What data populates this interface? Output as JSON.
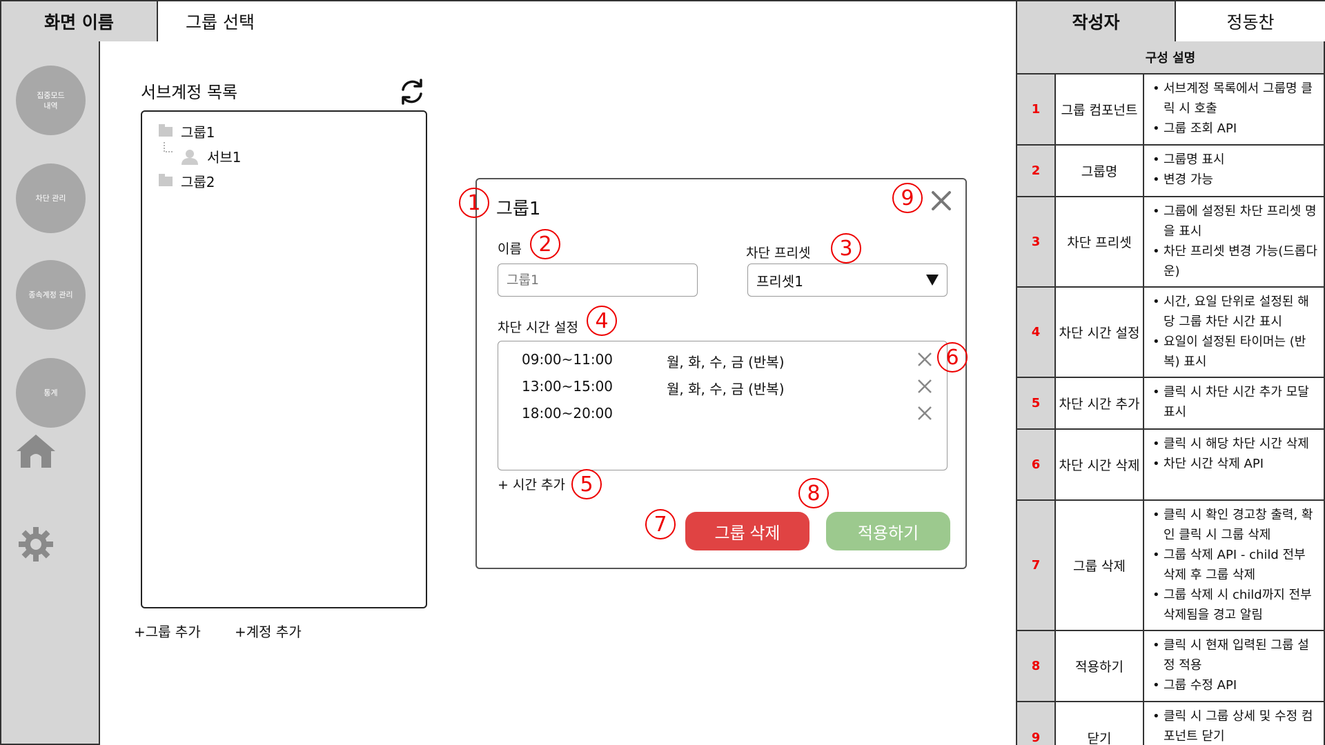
{
  "header": {
    "screen_name_label": "화면 이름",
    "screen_name_value": "그룹 선택",
    "author_label": "작성자",
    "author_value": "정동찬"
  },
  "nav": {
    "items": [
      {
        "label": "집중모드\n내역"
      },
      {
        "label": "차단 관리"
      },
      {
        "label": "종속계정 관리"
      },
      {
        "label": "통계"
      }
    ],
    "icons": [
      "home-icon",
      "gear-icon"
    ]
  },
  "sub_panel": {
    "title": "서브계정 목록",
    "tree": [
      {
        "type": "group",
        "label": "그룹1"
      },
      {
        "type": "account",
        "label": "서브1"
      },
      {
        "type": "group",
        "label": "그룹2"
      }
    ],
    "add_group": "+그룹 추가",
    "add_account": "+계정 추가"
  },
  "modal": {
    "title": "그룹1",
    "name_label": "이름",
    "name_placeholder": "그룹1",
    "preset_label": "차단 프리셋",
    "preset_value": "프리셋1",
    "time_label": "차단 시간 설정",
    "times": [
      {
        "time": "09:00~11:00",
        "days": "월, 화, 수, 금 (반복)"
      },
      {
        "time": "13:00~15:00",
        "days": "월, 화, 수, 금 (반복)"
      },
      {
        "time": "18:00~20:00",
        "days": ""
      }
    ],
    "add_time": "+ 시간 추가",
    "delete_button": "그룹 삭제",
    "apply_button": "적용하기"
  },
  "markers": [
    "1",
    "2",
    "3",
    "4",
    "5",
    "6",
    "7",
    "8",
    "9"
  ],
  "description": {
    "title": "구성 설명",
    "rows": [
      {
        "num": "1",
        "name": "그룹 컴포넌트",
        "items": [
          "서브계정 목록에서 그룹명 클릭 시 호출",
          "그룹 조회 API"
        ]
      },
      {
        "num": "2",
        "name": "그룹명",
        "items": [
          "그룹명 표시",
          "변경 가능"
        ]
      },
      {
        "num": "3",
        "name": "차단 프리셋",
        "items": [
          "그룹에 설정된 차단 프리셋 명을 표시",
          "차단 프리셋 변경 가능(드롭다운)"
        ]
      },
      {
        "num": "4",
        "name": "차단 시간 설정",
        "items": [
          "시간, 요일 단위로 설정된 해당 그룹 차단 시간 표시",
          "요일이 설정된 타이머는 (반복) 표시"
        ]
      },
      {
        "num": "5",
        "name": "차단 시간 추가",
        "items": [
          "클릭 시 차단 시간 추가 모달 표시"
        ]
      },
      {
        "num": "6",
        "name": "차단 시간 삭제",
        "items": [
          "클릭 시 해당 차단 시간 삭제",
          "차단 시간 삭제 API"
        ]
      },
      {
        "num": "7",
        "name": "그룹 삭제",
        "items": [
          "클릭 시 확인 경고창 출력, 확인 클릭 시 그룹 삭제",
          "그룹 삭제 API - child 전부 삭제 후 그룹 삭제",
          "그룹 삭제 시 child까지 전부 삭제됨을 경고 알림"
        ]
      },
      {
        "num": "8",
        "name": "적용하기",
        "items": [
          "클릭 시 현재 입력된 그룹 설정 적용",
          "그룹 수정 API"
        ]
      },
      {
        "num": "9",
        "name": "닫기",
        "items": [
          "클릭 시 그룹 상세 및 수정 컴포넌트 닫기"
        ]
      }
    ]
  }
}
